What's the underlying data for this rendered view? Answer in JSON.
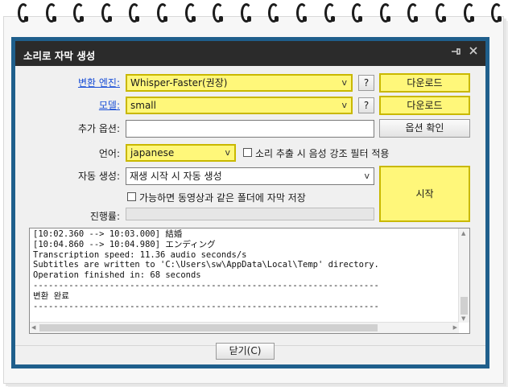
{
  "window": {
    "title": "소리로 자막 생성",
    "pin_icon": "pin-icon",
    "close_icon": "close-icon"
  },
  "engine": {
    "label": "변환 엔진:",
    "value": "Whisper-Faster(권장)",
    "help": "?",
    "download": "다운로드"
  },
  "model": {
    "label": "모델:",
    "value": "small",
    "help": "?",
    "download": "다운로드"
  },
  "extra_options": {
    "label": "추가 옵션:",
    "value": "",
    "confirm": "옵션 확인"
  },
  "language": {
    "label": "언어:",
    "value": "japanese",
    "voice_filter_label": "소리 추출 시 음성 강조 필터 적용"
  },
  "auto_generate": {
    "label": "자동 생성:",
    "value": "재생 시작 시 자동 생성",
    "save_same_folder_label": "가능하면 동영상과 같은 폴더에 자막 저장"
  },
  "progress": {
    "label": "진행률:",
    "value": 0
  },
  "start_button": "시작",
  "log_lines": [
    "[10:02.360 --> 10:03.000] 結婚",
    "[10:04.860 --> 10:04.980] エンディング",
    "Transcription speed: 11.36 audio seconds/s",
    "Subtitles are written to 'C:\\Users\\sw\\AppData\\Local\\Temp' directory.",
    "Operation finished in: 68 seconds",
    "--------------------------------------------------------------------",
    "변환 완료",
    "--------------------------------------------------------------------"
  ],
  "close_button": "닫기(C)"
}
